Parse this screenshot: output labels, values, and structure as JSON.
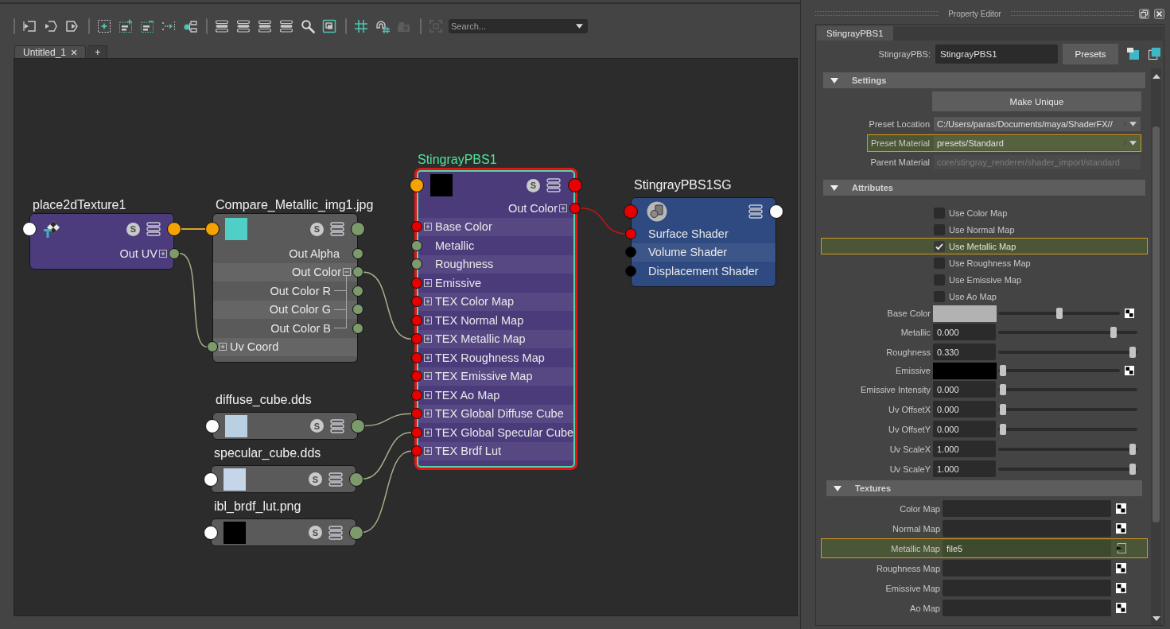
{
  "toolbar": {
    "groups": [
      [
        {
          "kind": "input",
          "disabled": false
        },
        {
          "kind": "passthrough",
          "disabled": false
        },
        {
          "kind": "output",
          "disabled": false
        }
      ],
      [
        {
          "kind": "frame",
          "disabled": false
        },
        {
          "kind": "group",
          "disabled": false
        },
        {
          "kind": "ungroup",
          "disabled": false
        },
        {
          "kind": "align",
          "disabled": false
        },
        {
          "kind": "pin",
          "disabled": false
        }
      ],
      [
        {
          "kind": "stack",
          "disabled": false
        },
        {
          "kind": "stack",
          "disabled": false
        },
        {
          "kind": "stack",
          "disabled": false
        },
        {
          "kind": "stack",
          "disabled": false
        },
        {
          "kind": "search",
          "disabled": false
        },
        {
          "kind": "focus",
          "disabled": false
        }
      ],
      [
        {
          "kind": "grid",
          "disabled": false
        },
        {
          "kind": "snap",
          "disabled": false
        },
        {
          "kind": "capture",
          "disabled": true
        }
      ],
      [
        {
          "kind": "fit",
          "disabled": true
        }
      ]
    ],
    "search": {
      "placeholder": "Search..."
    }
  },
  "tabs": [
    {
      "label": "Untitled_1",
      "selected": true,
      "close": "×"
    },
    {
      "label": "+",
      "selected": false
    }
  ],
  "graph": {
    "nodes": [
      {
        "title": "place2dTexture1",
        "kind": "placement",
        "selected": false,
        "badge": "S",
        "ports": [
          {
            "kind": "input",
            "color": "#ffffff"
          },
          {
            "kind": "output",
            "color": "#f5a300"
          }
        ],
        "rows": [
          {
            "label": "Out UV",
            "kind": "output",
            "color": "#7d9a6c",
            "expanded": false
          }
        ]
      },
      {
        "title": "Compare_Metallic_img1.jpg",
        "kind": "file",
        "selected": false,
        "badge": "S",
        "thumbnail": {
          "color": "#4fcfc6"
        },
        "ports": [
          {
            "kind": "input",
            "color": "#f5a300"
          },
          {
            "kind": "output",
            "color": "#7d9a6c"
          }
        ],
        "rows": [
          {
            "label": "Out Alpha",
            "kind": "output",
            "color": "#7d9a6c"
          },
          {
            "label": "Out Color",
            "kind": "output",
            "color": "#7d9a6c",
            "expanded": true,
            "children": [
              {
                "label": "Out Color R",
                "kind": "output",
                "color": "#7d9a6c"
              },
              {
                "label": "Out Color G",
                "kind": "output",
                "color": "#7d9a6c"
              },
              {
                "label": "Out Color B",
                "kind": "output",
                "color": "#7d9a6c"
              }
            ]
          },
          {
            "label": "Uv Coord",
            "kind": "input",
            "color": "#7d9a6c",
            "expanded": false
          }
        ]
      },
      {
        "title": "diffuse_cube.dds",
        "kind": "file",
        "selected": false,
        "badge": "S",
        "thumbnail": {
          "color": "#b9cfe2"
        },
        "ports": [
          {
            "kind": "input",
            "color": "#ffffff"
          },
          {
            "kind": "output",
            "color": "#7d9a6c"
          }
        ]
      },
      {
        "title": "specular_cube.dds",
        "kind": "file",
        "selected": false,
        "badge": "S",
        "thumbnail": {
          "color": "#c4d6e8"
        },
        "ports": [
          {
            "kind": "input",
            "color": "#ffffff"
          },
          {
            "kind": "output",
            "color": "#7d9a6c"
          }
        ]
      },
      {
        "title": "ibl_brdf_lut.png",
        "kind": "file",
        "selected": false,
        "badge": "S",
        "thumbnail": {
          "color": "#000000"
        },
        "ports": [
          {
            "kind": "input",
            "color": "#ffffff"
          },
          {
            "kind": "output",
            "color": "#7d9a6c"
          }
        ]
      },
      {
        "title": "StingrayPBS1",
        "kind": "material",
        "selected": true,
        "badge": "S",
        "thumbnail": {
          "color": "#000000"
        },
        "ports": [
          {
            "kind": "input",
            "color": "#f5a300"
          },
          {
            "kind": "output",
            "color": "#e60000"
          }
        ],
        "rows": [
          {
            "label": "Out Color",
            "kind": "output",
            "color": "#e60000",
            "expanded": false
          },
          {
            "label": "Base Color",
            "kind": "input",
            "color": "#e60000",
            "expanded": false
          },
          {
            "label": "Metallic",
            "kind": "input",
            "color": "#7d9a6c"
          },
          {
            "label": "Roughness",
            "kind": "input",
            "color": "#7d9a6c"
          },
          {
            "label": "Emissive",
            "kind": "input",
            "color": "#e60000",
            "expanded": false
          },
          {
            "label": "TEX Color Map",
            "kind": "input",
            "color": "#e60000",
            "expanded": false
          },
          {
            "label": "TEX Normal Map",
            "kind": "input",
            "color": "#e60000",
            "expanded": false
          },
          {
            "label": "TEX Metallic Map",
            "kind": "input",
            "color": "#e60000",
            "expanded": false
          },
          {
            "label": "TEX Roughness Map",
            "kind": "input",
            "color": "#e60000",
            "expanded": false
          },
          {
            "label": "TEX Emissive Map",
            "kind": "input",
            "color": "#e60000",
            "expanded": false
          },
          {
            "label": "TEX Ao Map",
            "kind": "input",
            "color": "#e60000",
            "expanded": false
          },
          {
            "label": "TEX Global Diffuse Cube",
            "kind": "input",
            "color": "#e60000",
            "expanded": false
          },
          {
            "label": "TEX Global Specular Cube",
            "kind": "input",
            "color": "#e60000",
            "expanded": false
          },
          {
            "label": "TEX Brdf Lut",
            "kind": "input",
            "color": "#e60000",
            "expanded": false
          }
        ]
      },
      {
        "title": "StingrayPBS1SG",
        "kind": "group",
        "selected": false,
        "ports": [
          {
            "kind": "input",
            "color": "#e60000"
          },
          {
            "kind": "output",
            "color": "#ffffff"
          }
        ],
        "rows": [
          {
            "label": "Surface Shader",
            "kind": "input",
            "color": "#e60000"
          },
          {
            "label": "Volume Shader",
            "kind": "input",
            "color": "#000000"
          },
          {
            "label": "Displacement Shader",
            "kind": "input",
            "color": "#000000"
          }
        ]
      }
    ]
  },
  "property_editor": {
    "title": "Property Editor",
    "tabs": [
      {
        "label": "StingrayPBS1",
        "selected": true
      }
    ],
    "name_field": {
      "label": "StingrayPBS:",
      "value": "StingrayPBS1"
    },
    "presets_button": "Presets",
    "settings": {
      "title": "Settings",
      "expanded": true,
      "button": "Make Unique",
      "fields": [
        {
          "label": "Preset Location",
          "value": "C:/Users/paras/Documents/maya/ShaderFX//",
          "kind": "dropdown",
          "highlighted": false,
          "disabled": false
        },
        {
          "label": "Preset Material",
          "value": "presets/Standard",
          "kind": "dropdown",
          "highlighted": true,
          "disabled": false
        },
        {
          "label": "Parent Material",
          "value": "core/stingray_renderer/shader_import/standard",
          "kind": "text",
          "highlighted": false,
          "disabled": true
        }
      ]
    },
    "attributes": {
      "title": "Attributes",
      "expanded": true,
      "toggles": [
        {
          "label": "Use Color Map",
          "checked": false,
          "highlighted": false
        },
        {
          "label": "Use Normal Map",
          "checked": false,
          "highlighted": false
        },
        {
          "label": "Use Metallic Map",
          "checked": true,
          "highlighted": true
        },
        {
          "label": "Use Roughness Map",
          "checked": false,
          "highlighted": false
        },
        {
          "label": "Use Emissive Map",
          "checked": false,
          "highlighted": false
        },
        {
          "label": "Use Ao Map",
          "checked": false,
          "highlighted": false
        }
      ],
      "params": [
        {
          "label": "Base Color",
          "kind": "color",
          "color": "#b2b2b2",
          "level": 0.5
        },
        {
          "label": "Metallic",
          "kind": "number",
          "value": "0.000",
          "level": 0.85
        },
        {
          "label": "Roughness",
          "kind": "number",
          "value": "0.330",
          "level": 1
        },
        {
          "label": "Emissive",
          "kind": "color",
          "color": "#000000",
          "level": 0
        },
        {
          "label": "Emissive Intensity",
          "kind": "number",
          "value": "0.000",
          "level": 0
        },
        {
          "label": "Uv OffsetX",
          "kind": "number",
          "value": "0.000",
          "level": 0
        },
        {
          "label": "Uv OffsetY",
          "kind": "number",
          "value": "0.000",
          "level": 0
        },
        {
          "label": "Uv ScaleX",
          "kind": "number",
          "value": "1.000",
          "level": 1
        },
        {
          "label": "Uv ScaleY",
          "kind": "number",
          "value": "1.000",
          "level": 1
        }
      ]
    },
    "textures": {
      "title": "Textures",
      "expanded": true,
      "maps": [
        {
          "label": "Color Map",
          "connected": false,
          "highlighted": false
        },
        {
          "label": "Normal Map",
          "connected": false,
          "highlighted": false
        },
        {
          "label": "Metallic Map",
          "value": "file5",
          "connected": true,
          "highlighted": true
        },
        {
          "label": "Roughness Map",
          "connected": false,
          "highlighted": false
        },
        {
          "label": "Emissive Map",
          "connected": false,
          "highlighted": false
        },
        {
          "label": "Ao Map",
          "connected": false,
          "highlighted": false
        }
      ]
    }
  }
}
